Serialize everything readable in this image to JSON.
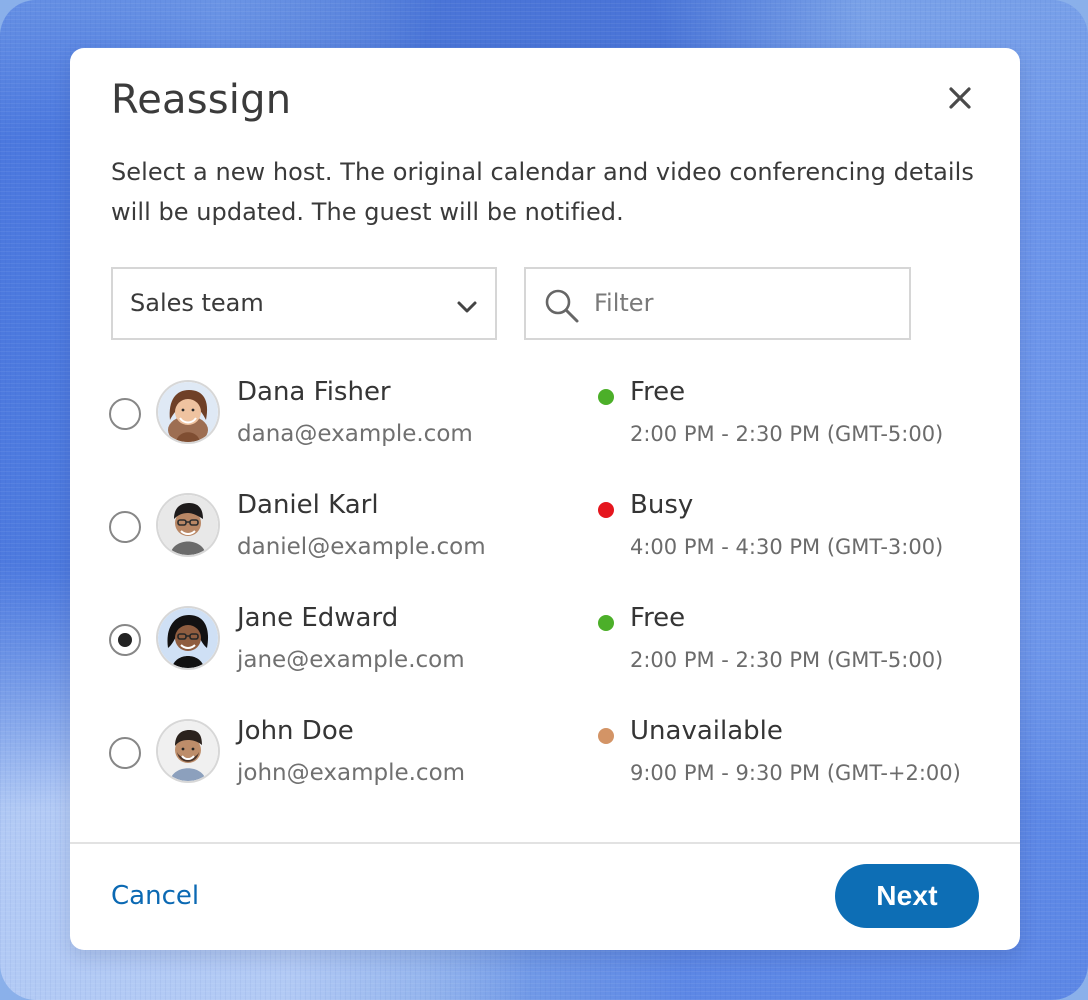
{
  "dialog": {
    "title": "Reassign",
    "description": "Select a new host. The original calendar and video conferencing details will be updated. The guest will be notified.",
    "close_icon": "close-icon"
  },
  "team_selector": {
    "value": "Sales team",
    "icon": "chevron-down-icon"
  },
  "filter": {
    "placeholder": "Filter",
    "value": "",
    "icon": "search-icon"
  },
  "hosts": [
    {
      "name": "Dana Fisher",
      "email": "dana@example.com",
      "status": "Free",
      "time": "2:00 PM - 2:30 PM (GMT-5:00)",
      "selected": false,
      "status_color": "#4caf29",
      "avatar_icon": "avatar-icon"
    },
    {
      "name": "Daniel Karl",
      "email": "daniel@example.com",
      "status": "Busy",
      "time": "4:00 PM - 4:30 PM (GMT-3:00)",
      "selected": false,
      "status_color": "#e5161e",
      "avatar_icon": "avatar-icon"
    },
    {
      "name": "Jane Edward",
      "email": "jane@example.com",
      "status": "Free",
      "time": "2:00 PM - 2:30 PM (GMT-5:00)",
      "selected": true,
      "status_color": "#4caf29",
      "avatar_icon": "avatar-icon"
    },
    {
      "name": "John Doe",
      "email": "john@example.com",
      "status": "Unavailable",
      "time": "9:00 PM - 9:30 PM (GMT-+2:00)",
      "selected": false,
      "status_color": "#d39466",
      "avatar_icon": "avatar-icon"
    }
  ],
  "footer": {
    "cancel_label": "Cancel",
    "next_label": "Next"
  },
  "colors": {
    "accent": "#0d6eb5",
    "link": "#0b69b3",
    "text": "#353535",
    "muted_text": "#707070",
    "border": "#d6d6d6",
    "background_blue": "#7aa2e8"
  }
}
